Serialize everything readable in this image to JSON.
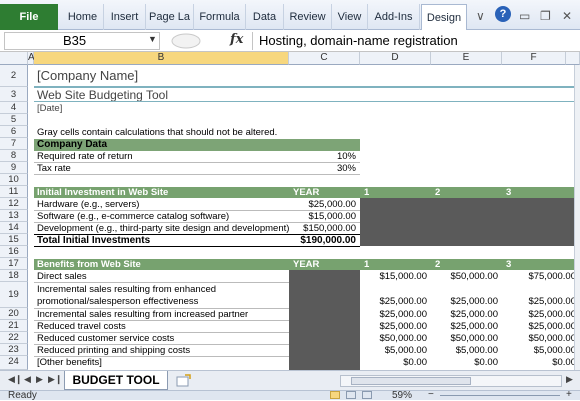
{
  "ribbon": {
    "file_tab": "File",
    "tabs": [
      "Home",
      "Insert",
      "Page La",
      "Formula",
      "Data",
      "Review",
      "View",
      "Add-Ins",
      "Design"
    ],
    "help_label": "?"
  },
  "formula_bar": {
    "name_box": "B35",
    "fx_label": "fx",
    "formula": "Hosting, domain-name registration"
  },
  "columns": [
    "A",
    "B",
    "C",
    "D",
    "E",
    "F"
  ],
  "rows": [
    "2",
    "3",
    "4",
    "5",
    "6",
    "7",
    "8",
    "9",
    "10",
    "11",
    "12",
    "13",
    "14",
    "15",
    "16",
    "17",
    "18",
    "19",
    "20",
    "21",
    "22",
    "23",
    "24"
  ],
  "sheet": {
    "company_name": "[Company Name]",
    "title": "Web Site Budgeting Tool",
    "date": "[Date]",
    "note": "Gray cells contain calculations that should not be altered.",
    "company_data": {
      "header": "Company Data",
      "rows": [
        {
          "label": "Required rate of return",
          "value": "10%"
        },
        {
          "label": "Tax rate",
          "value": "30%"
        }
      ]
    },
    "initial_investment": {
      "header": "Initial Investment in Web Site",
      "year_label": "YEAR",
      "years": [
        "1",
        "2",
        "3"
      ],
      "rows": [
        {
          "label": "Hardware (e.g., servers)",
          "value": "$25,000.00"
        },
        {
          "label": "Software (e.g., e-commerce catalog software)",
          "value": "$15,000.00"
        },
        {
          "label": "Development (e.g., third-party site design and development)",
          "value": "$150,000.00"
        }
      ],
      "total_label": "Total Initial Investments",
      "total_value": "$190,000.00"
    },
    "benefits": {
      "header": "Benefits from Web Site",
      "year_label": "YEAR",
      "years": [
        "1",
        "2",
        "3"
      ],
      "rows": [
        {
          "label": "Direct sales",
          "d": "$15,000.00",
          "e": "$50,000.00",
          "f": "$75,000.00"
        },
        {
          "label": "Incremental sales resulting from enhanced",
          "d": "",
          "e": "",
          "f": ""
        },
        {
          "label": "promotional/salesperson effectiveness",
          "d": "$25,000.00",
          "e": "$25,000.00",
          "f": "$25,000.00"
        },
        {
          "label": "Incremental sales resulting from increased partner",
          "d": "$25,000.00",
          "e": "$25,000.00",
          "f": "$25,000.00"
        },
        {
          "label": "Reduced travel costs",
          "d": "$25,000.00",
          "e": "$25,000.00",
          "f": "$25,000.00"
        },
        {
          "label": "Reduced customer service costs",
          "d": "$50,000.00",
          "e": "$50,000.00",
          "f": "$50,000.00"
        },
        {
          "label": "Reduced printing and shipping costs",
          "d": "$5,000.00",
          "e": "$5,000.00",
          "f": "$5,000.00"
        },
        {
          "label": "[Other benefits]",
          "d": "$0.00",
          "e": "$0.00",
          "f": "$0.00"
        }
      ]
    }
  },
  "sheet_tabs": [
    "BUDGET TOOL"
  ],
  "status": {
    "ready": "Ready",
    "zoom": "59%"
  }
}
